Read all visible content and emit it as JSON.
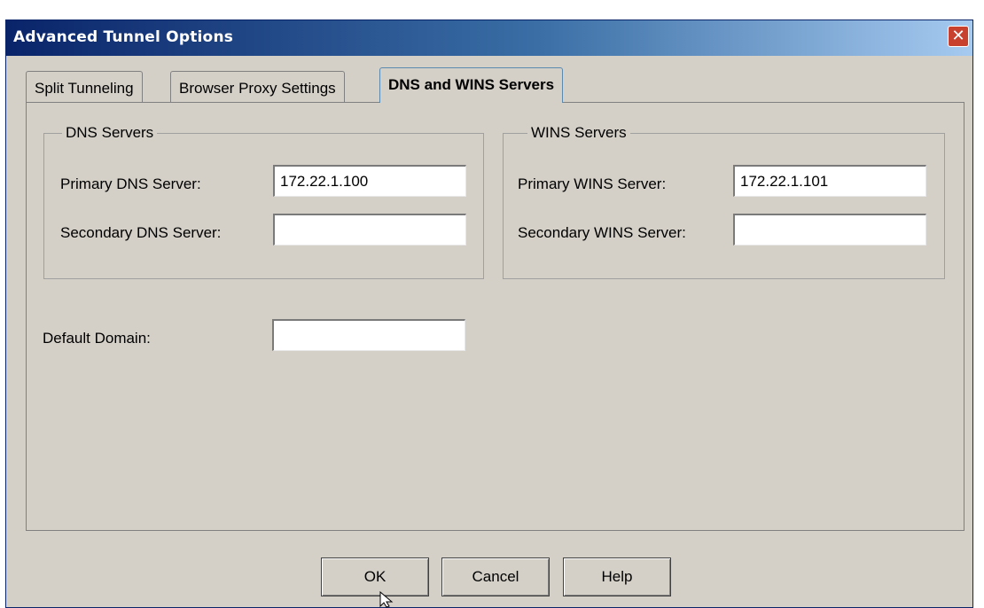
{
  "window": {
    "title": "Advanced Tunnel Options",
    "close_icon": "close-icon"
  },
  "tabs": [
    {
      "label": "Split Tunneling",
      "active": false
    },
    {
      "label": "Browser Proxy Settings",
      "active": false
    },
    {
      "label": "DNS and WINS Servers",
      "active": true
    }
  ],
  "dns": {
    "legend": "DNS Servers",
    "primary_label": "Primary DNS Server:",
    "primary_value": "172.22.1.100",
    "secondary_label": "Secondary DNS Server:",
    "secondary_value": ""
  },
  "wins": {
    "legend": "WINS Servers",
    "primary_label": "Primary WINS Server:",
    "primary_value": "172.22.1.101",
    "secondary_label": "Secondary WINS Server:",
    "secondary_value": ""
  },
  "domain": {
    "label": "Default Domain:",
    "value": ""
  },
  "buttons": {
    "ok": "OK",
    "cancel": "Cancel",
    "help": "Help"
  },
  "colors": {
    "title_start": "#0a246a",
    "title_end": "#a6caf0",
    "dialog_bg": "#d4d0c8",
    "close_red": "#c8402e"
  }
}
